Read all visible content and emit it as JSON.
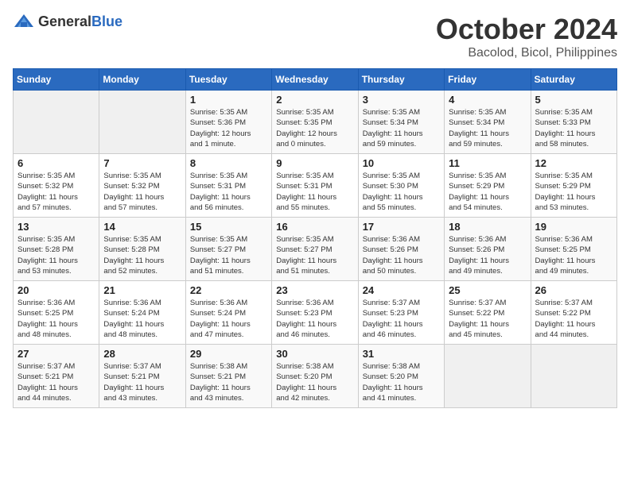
{
  "header": {
    "logo_general": "General",
    "logo_blue": "Blue",
    "month": "October 2024",
    "location": "Bacolod, Bicol, Philippines"
  },
  "weekdays": [
    "Sunday",
    "Monday",
    "Tuesday",
    "Wednesday",
    "Thursday",
    "Friday",
    "Saturday"
  ],
  "weeks": [
    [
      {
        "day": "",
        "detail": ""
      },
      {
        "day": "",
        "detail": ""
      },
      {
        "day": "1",
        "detail": "Sunrise: 5:35 AM\nSunset: 5:36 PM\nDaylight: 12 hours\nand 1 minute."
      },
      {
        "day": "2",
        "detail": "Sunrise: 5:35 AM\nSunset: 5:35 PM\nDaylight: 12 hours\nand 0 minutes."
      },
      {
        "day": "3",
        "detail": "Sunrise: 5:35 AM\nSunset: 5:34 PM\nDaylight: 11 hours\nand 59 minutes."
      },
      {
        "day": "4",
        "detail": "Sunrise: 5:35 AM\nSunset: 5:34 PM\nDaylight: 11 hours\nand 59 minutes."
      },
      {
        "day": "5",
        "detail": "Sunrise: 5:35 AM\nSunset: 5:33 PM\nDaylight: 11 hours\nand 58 minutes."
      }
    ],
    [
      {
        "day": "6",
        "detail": "Sunrise: 5:35 AM\nSunset: 5:32 PM\nDaylight: 11 hours\nand 57 minutes."
      },
      {
        "day": "7",
        "detail": "Sunrise: 5:35 AM\nSunset: 5:32 PM\nDaylight: 11 hours\nand 57 minutes."
      },
      {
        "day": "8",
        "detail": "Sunrise: 5:35 AM\nSunset: 5:31 PM\nDaylight: 11 hours\nand 56 minutes."
      },
      {
        "day": "9",
        "detail": "Sunrise: 5:35 AM\nSunset: 5:31 PM\nDaylight: 11 hours\nand 55 minutes."
      },
      {
        "day": "10",
        "detail": "Sunrise: 5:35 AM\nSunset: 5:30 PM\nDaylight: 11 hours\nand 55 minutes."
      },
      {
        "day": "11",
        "detail": "Sunrise: 5:35 AM\nSunset: 5:29 PM\nDaylight: 11 hours\nand 54 minutes."
      },
      {
        "day": "12",
        "detail": "Sunrise: 5:35 AM\nSunset: 5:29 PM\nDaylight: 11 hours\nand 53 minutes."
      }
    ],
    [
      {
        "day": "13",
        "detail": "Sunrise: 5:35 AM\nSunset: 5:28 PM\nDaylight: 11 hours\nand 53 minutes."
      },
      {
        "day": "14",
        "detail": "Sunrise: 5:35 AM\nSunset: 5:28 PM\nDaylight: 11 hours\nand 52 minutes."
      },
      {
        "day": "15",
        "detail": "Sunrise: 5:35 AM\nSunset: 5:27 PM\nDaylight: 11 hours\nand 51 minutes."
      },
      {
        "day": "16",
        "detail": "Sunrise: 5:35 AM\nSunset: 5:27 PM\nDaylight: 11 hours\nand 51 minutes."
      },
      {
        "day": "17",
        "detail": "Sunrise: 5:36 AM\nSunset: 5:26 PM\nDaylight: 11 hours\nand 50 minutes."
      },
      {
        "day": "18",
        "detail": "Sunrise: 5:36 AM\nSunset: 5:26 PM\nDaylight: 11 hours\nand 49 minutes."
      },
      {
        "day": "19",
        "detail": "Sunrise: 5:36 AM\nSunset: 5:25 PM\nDaylight: 11 hours\nand 49 minutes."
      }
    ],
    [
      {
        "day": "20",
        "detail": "Sunrise: 5:36 AM\nSunset: 5:25 PM\nDaylight: 11 hours\nand 48 minutes."
      },
      {
        "day": "21",
        "detail": "Sunrise: 5:36 AM\nSunset: 5:24 PM\nDaylight: 11 hours\nand 48 minutes."
      },
      {
        "day": "22",
        "detail": "Sunrise: 5:36 AM\nSunset: 5:24 PM\nDaylight: 11 hours\nand 47 minutes."
      },
      {
        "day": "23",
        "detail": "Sunrise: 5:36 AM\nSunset: 5:23 PM\nDaylight: 11 hours\nand 46 minutes."
      },
      {
        "day": "24",
        "detail": "Sunrise: 5:37 AM\nSunset: 5:23 PM\nDaylight: 11 hours\nand 46 minutes."
      },
      {
        "day": "25",
        "detail": "Sunrise: 5:37 AM\nSunset: 5:22 PM\nDaylight: 11 hours\nand 45 minutes."
      },
      {
        "day": "26",
        "detail": "Sunrise: 5:37 AM\nSunset: 5:22 PM\nDaylight: 11 hours\nand 44 minutes."
      }
    ],
    [
      {
        "day": "27",
        "detail": "Sunrise: 5:37 AM\nSunset: 5:21 PM\nDaylight: 11 hours\nand 44 minutes."
      },
      {
        "day": "28",
        "detail": "Sunrise: 5:37 AM\nSunset: 5:21 PM\nDaylight: 11 hours\nand 43 minutes."
      },
      {
        "day": "29",
        "detail": "Sunrise: 5:38 AM\nSunset: 5:21 PM\nDaylight: 11 hours\nand 43 minutes."
      },
      {
        "day": "30",
        "detail": "Sunrise: 5:38 AM\nSunset: 5:20 PM\nDaylight: 11 hours\nand 42 minutes."
      },
      {
        "day": "31",
        "detail": "Sunrise: 5:38 AM\nSunset: 5:20 PM\nDaylight: 11 hours\nand 41 minutes."
      },
      {
        "day": "",
        "detail": ""
      },
      {
        "day": "",
        "detail": ""
      }
    ]
  ]
}
